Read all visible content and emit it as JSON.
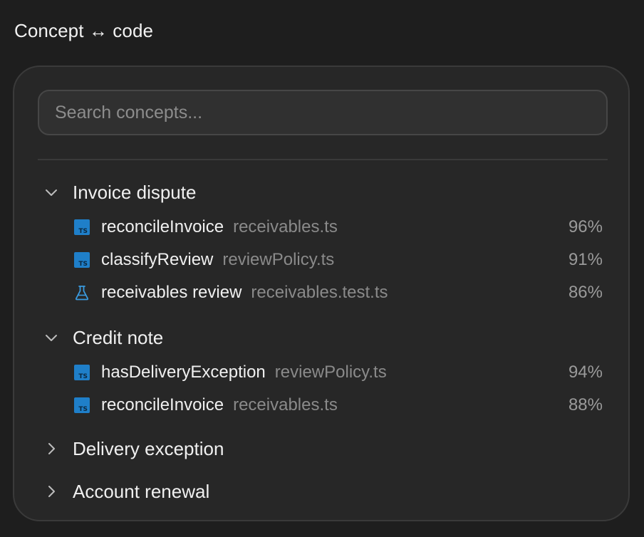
{
  "header": {
    "title": "Concept ↔ code"
  },
  "search": {
    "placeholder": "Search concepts..."
  },
  "colors": {
    "ts_icon": "#1f7fc9",
    "test_icon": "#3a9be0",
    "background": "#1e1e1e",
    "card": "#272727"
  },
  "groups": [
    {
      "label": "Invoice dispute",
      "expanded": true,
      "items": [
        {
          "icon": "typescript-file-icon",
          "symbol": "reconcileInvoice",
          "file": "receivables.ts",
          "score": "96%"
        },
        {
          "icon": "typescript-file-icon",
          "symbol": "classifyReview",
          "file": "reviewPolicy.ts",
          "score": "91%"
        },
        {
          "icon": "test-flask-icon",
          "symbol": "receivables review",
          "file": "receivables.test.ts",
          "score": "86%"
        }
      ]
    },
    {
      "label": "Credit note",
      "expanded": true,
      "items": [
        {
          "icon": "typescript-file-icon",
          "symbol": "hasDeliveryException",
          "file": "reviewPolicy.ts",
          "score": "94%"
        },
        {
          "icon": "typescript-file-icon",
          "symbol": "reconcileInvoice",
          "file": "receivables.ts",
          "score": "88%"
        }
      ]
    },
    {
      "label": "Delivery exception",
      "expanded": false,
      "items": []
    },
    {
      "label": "Account renewal",
      "expanded": false,
      "items": []
    }
  ]
}
